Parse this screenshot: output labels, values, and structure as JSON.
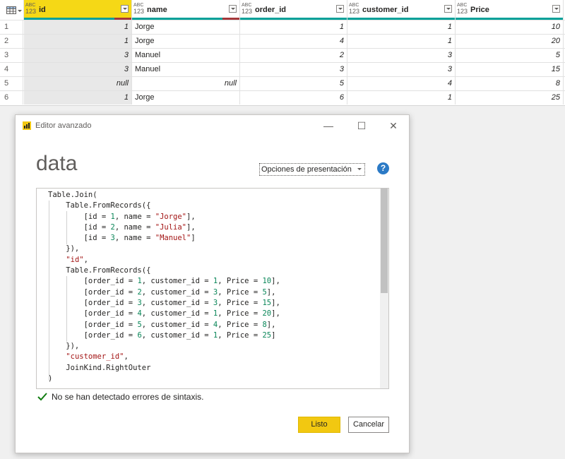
{
  "grid": {
    "columns": [
      {
        "type_top": "ABC",
        "type_bottom": "123",
        "name": "id"
      },
      {
        "type_top": "ABC",
        "type_bottom": "123",
        "name": "name"
      },
      {
        "type_top": "ABC",
        "type_bottom": "123",
        "name": "order_id"
      },
      {
        "type_top": "ABC",
        "type_bottom": "123",
        "name": "customer_id"
      },
      {
        "type_top": "ABC",
        "type_bottom": "123",
        "name": "Price"
      }
    ],
    "rows": [
      {
        "n": "1",
        "id": "1",
        "name": "Jorge",
        "order_id": "1",
        "customer_id": "1",
        "price": "10"
      },
      {
        "n": "2",
        "id": "1",
        "name": "Jorge",
        "order_id": "4",
        "customer_id": "1",
        "price": "20"
      },
      {
        "n": "3",
        "id": "3",
        "name": "Manuel",
        "order_id": "2",
        "customer_id": "3",
        "price": "5"
      },
      {
        "n": "4",
        "id": "3",
        "name": "Manuel",
        "order_id": "3",
        "customer_id": "3",
        "price": "15"
      },
      {
        "n": "5",
        "id": "null",
        "name": "null",
        "order_id": "5",
        "customer_id": "4",
        "price": "8"
      },
      {
        "n": "6",
        "id": "1",
        "name": "Jorge",
        "order_id": "6",
        "customer_id": "1",
        "price": "25"
      }
    ],
    "colors": {
      "quality_ok": "#00a199",
      "quality_error": "#a4373a",
      "selected_header": "#f5d816"
    }
  },
  "dialog": {
    "title": "Editor avanzado",
    "minimize": "—",
    "maximize": "☐",
    "close": "✕",
    "heading": "data",
    "display_options": "Opciones de presentación",
    "help": "?",
    "code_lines": [
      "Table.Join(",
      "    Table.FromRecords({",
      "        [id = 1, name = \"Jorge\"],",
      "        [id = 2, name = \"Julia\"],",
      "        [id = 3, name = \"Manuel\"]",
      "    }),",
      "    \"id\",",
      "    Table.FromRecords({",
      "        [order_id = 1, customer_id = 1, Price = 10],",
      "        [order_id = 2, customer_id = 3, Price = 5],",
      "        [order_id = 3, customer_id = 3, Price = 15],",
      "        [order_id = 4, customer_id = 1, Price = 20],",
      "        [order_id = 5, customer_id = 4, Price = 8],",
      "        [order_id = 6, customer_id = 1, Price = 25]",
      "    }),",
      "    \"customer_id\",",
      "    JoinKind.RightOuter",
      ")"
    ],
    "status": "No se han detectado errores de sintaxis.",
    "ok_label": "Listo",
    "cancel_label": "Cancelar",
    "accent": "#f2c811"
  }
}
